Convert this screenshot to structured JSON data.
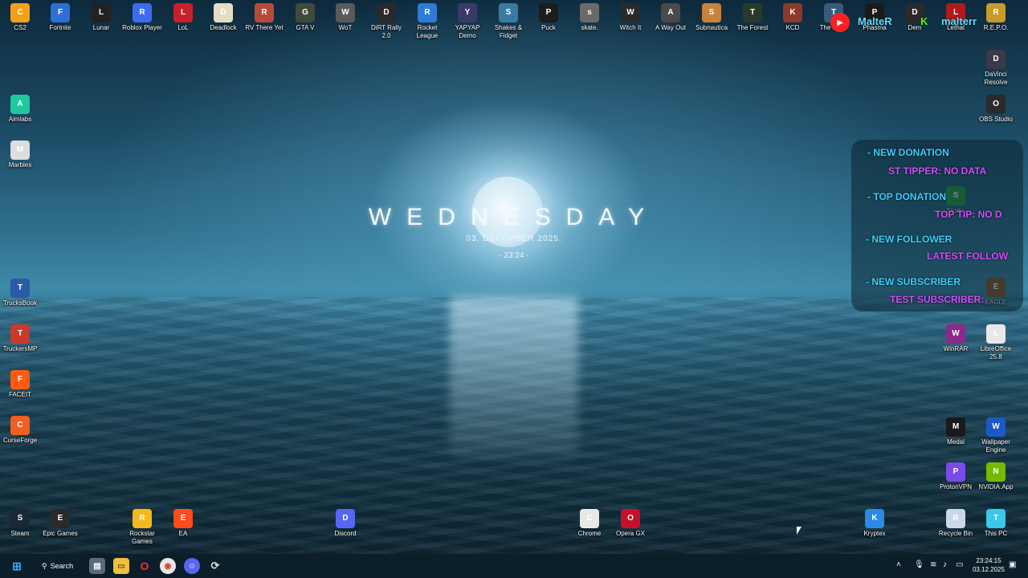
{
  "wallpaper": {
    "day": "WEDNESDAY",
    "date": "03. DECEMBER 2025.",
    "time": "- 23:24 -"
  },
  "desktop_icons_top": [
    {
      "label": "CS2",
      "icon": "cs2-icon",
      "color": "#f4a11a"
    },
    {
      "label": "Fortnite",
      "icon": "fortnite-icon",
      "color": "#2c6fd6"
    },
    {
      "label": "Lunar",
      "icon": "lunar-icon",
      "color": "#222222"
    },
    {
      "label": "Roblox Player",
      "icon": "roblox-icon",
      "color": "#3b6cf0"
    },
    {
      "label": "LoL",
      "icon": "lol-icon",
      "color": "#c8202a"
    },
    {
      "label": "Deadlock",
      "icon": "deadlock-icon",
      "color": "#e6dcc6"
    },
    {
      "label": "RV There Yet",
      "icon": "rv-icon",
      "color": "#b84a3a"
    },
    {
      "label": "GTA V",
      "icon": "gta-icon",
      "color": "#3f4a3a"
    },
    {
      "label": "WoT",
      "icon": "wot-icon",
      "color": "#5a5a5a"
    },
    {
      "label": "DiRT Rally 2.0",
      "icon": "dirt-icon",
      "color": "#2a2a2a"
    },
    {
      "label": "Rocket League",
      "icon": "rocket-league-icon",
      "color": "#2f7ad8"
    },
    {
      "label": "YAPYAP Demo",
      "icon": "yapyap-icon",
      "color": "#3a3a6a"
    },
    {
      "label": "Shakes & Fidget",
      "icon": "shakes-icon",
      "color": "#3a7aa0"
    },
    {
      "label": "Puck",
      "icon": "puck-icon",
      "color": "#1c1c1c"
    },
    {
      "label": "skate.",
      "icon": "skate-icon",
      "color": "#6a6a6a"
    },
    {
      "label": "Witch It",
      "icon": "witchit-icon",
      "color": "#2a2a2a"
    },
    {
      "label": "A Way Out",
      "icon": "awayout-icon",
      "color": "#4a4a4a"
    },
    {
      "label": "Subnautica",
      "icon": "subnautica-icon",
      "color": "#c8823a"
    },
    {
      "label": "The Forest",
      "icon": "forest-icon",
      "color": "#2a3a2a"
    },
    {
      "label": "KCD",
      "icon": "kcd-icon",
      "color": "#8a3a2a"
    },
    {
      "label": "The Drive",
      "icon": "drive-icon",
      "color": "#3a5a7a"
    },
    {
      "label": "Phasma",
      "icon": "phasma-icon",
      "color": "#1a1a1a"
    },
    {
      "label": "Dem",
      "icon": "dem-icon",
      "color": "#2a2a2a"
    },
    {
      "label": "Lethal",
      "icon": "lethal-icon",
      "color": "#b01a1a"
    },
    {
      "label": "R.E.P.O.",
      "icon": "repo-icon",
      "color": "#c89a2a"
    }
  ],
  "desktop_icons_left": [
    {
      "label": "Aimlabs",
      "icon": "aimlabs-icon",
      "color": "#1fc8a0"
    },
    {
      "label": "Marbles",
      "icon": "marbles-icon",
      "color": "#dddddd"
    },
    {
      "label": "TrucksBook",
      "icon": "trucksbook-icon",
      "color": "#2a5aa8"
    },
    {
      "label": "TruckersMP",
      "icon": "truckersmp-icon",
      "color": "#c83a2a"
    },
    {
      "label": "FACEIT",
      "icon": "faceit-icon",
      "color": "#ff5a10"
    },
    {
      "label": "CurseForge",
      "icon": "curseforge-icon",
      "color": "#f06020"
    }
  ],
  "desktop_icons_right": [
    {
      "label": "DaVinci Resolve",
      "icon": "davinci-icon",
      "color": "#3a3a4a"
    },
    {
      "label": "OBS Studio",
      "icon": "obs-icon",
      "color": "#2a2a2a"
    },
    {
      "label": "Studio",
      "icon": "studio-icon",
      "color": "#2aa040"
    },
    {
      "label": "EAGLE",
      "icon": "eagle-icon",
      "color": "#8a5a2a"
    },
    {
      "label": "WinRAR",
      "icon": "winrar-icon",
      "color": "#8a2a8a"
    },
    {
      "label": "LibreOffice 25.8",
      "icon": "libreoffice-icon",
      "color": "#e8e8e8"
    },
    {
      "label": "Medal",
      "icon": "medal-icon",
      "color": "#1a1a1a"
    },
    {
      "label": "Wallpaper Engine",
      "icon": "wallpaper-engine-icon",
      "color": "#1a5ac8"
    },
    {
      "label": "ProtonVPN",
      "icon": "protonvpn-icon",
      "color": "#7a4aea"
    },
    {
      "label": "NVIDIA.App",
      "icon": "nvidia-icon",
      "color": "#76b900"
    }
  ],
  "desktop_icons_bottom": [
    {
      "label": "Steam",
      "icon": "steam-icon",
      "color": "#1b2838"
    },
    {
      "label": "Epic Games",
      "icon": "epic-icon",
      "color": "#2a2a2a"
    },
    {
      "label": "Rockstar Games",
      "icon": "rockstar-icon",
      "color": "#f6b81a"
    },
    {
      "label": "EA",
      "icon": "ea-icon",
      "color": "#ff4a1a"
    },
    {
      "label": "Discord",
      "icon": "discord-icon",
      "color": "#5865f2"
    },
    {
      "label": "Chrome",
      "icon": "chrome-icon",
      "color": "#e8e8e8"
    },
    {
      "label": "Opera GX",
      "icon": "operagx-icon",
      "color": "#c8102e"
    },
    {
      "label": "Kryptex",
      "icon": "kryptex-icon",
      "color": "#2a8ae8"
    },
    {
      "label": "Recycle Bin",
      "icon": "recycle-bin-icon",
      "color": "#c8d8e8"
    },
    {
      "label": "This PC",
      "icon": "this-pc-icon",
      "color": "#3ac8e8"
    }
  ],
  "stream_overlay": {
    "new_donation": "- NEW DONATION",
    "tipper": "ST TIPPER: NO DATA",
    "top_donation": "- TOP DONATION",
    "top_tip": "TOP TIP: NO D",
    "new_follower": "- NEW FOLLOWER",
    "latest_follow": "LATEST FOLLOW",
    "new_subscriber": "- NEW SUBSCRIBER",
    "test_subscriber": "TEST SUBSCRIBER:"
  },
  "stream_handles": {
    "youtube": "MalteR",
    "kick": "malterr"
  },
  "taskbar": {
    "search_label": "Search",
    "items": [
      "start-icon",
      "search-icon",
      "widgets-icon",
      "file-explorer-icon",
      "opera-icon",
      "chrome-icon",
      "discord-icon",
      "app-icon"
    ],
    "clock_time": "23:24:15",
    "clock_date": "03.12.2025"
  }
}
